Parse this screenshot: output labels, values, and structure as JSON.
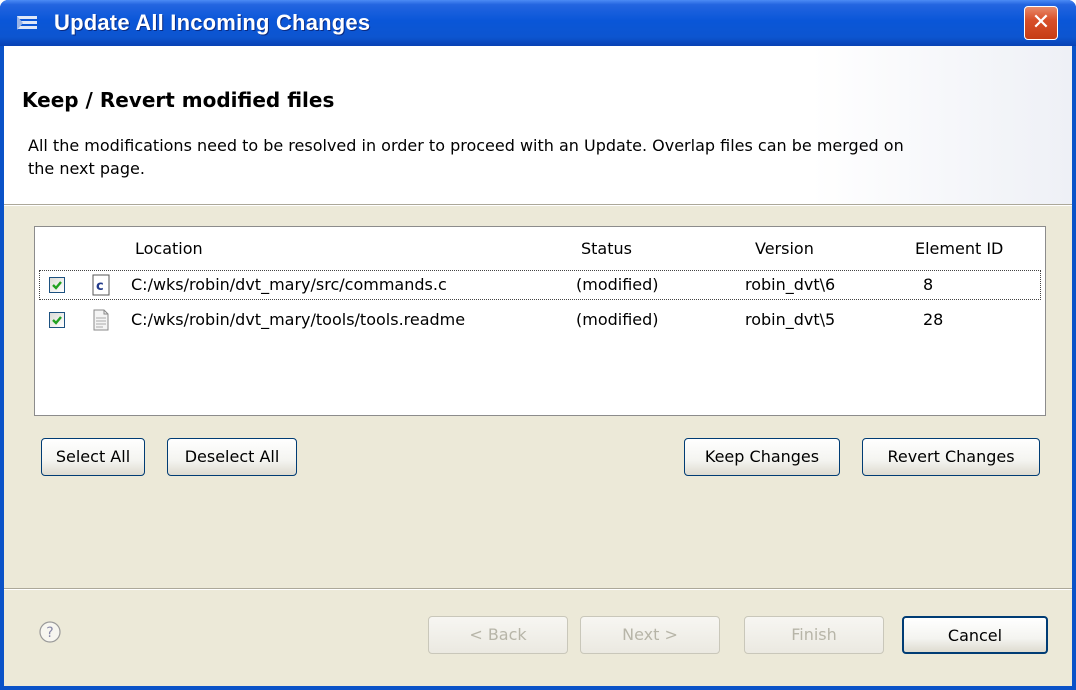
{
  "window": {
    "title": "Update All Incoming Changes",
    "close_glyph": "✕"
  },
  "header": {
    "title": "Keep / Revert modified files",
    "description": "All the modifications need to be resolved in order to proceed with an Update. Overlap files can be merged on the next page."
  },
  "table": {
    "columns": [
      "Location",
      "Status",
      "Version",
      "Element ID"
    ],
    "rows": [
      {
        "checked": true,
        "icon": "c-source-file-icon",
        "location": "C:/wks/robin/dvt_mary/src/commands.c",
        "status": "(modified)",
        "version": "robin_dvt\\6",
        "element_id": "8"
      },
      {
        "checked": true,
        "icon": "text-file-icon",
        "location": "C:/wks/robin/dvt_mary/tools/tools.readme",
        "status": "(modified)",
        "version": "robin_dvt\\5",
        "element_id": "28"
      }
    ]
  },
  "buttons": {
    "select_all": "Select All",
    "deselect_all": "Deselect All",
    "keep_changes": "Keep Changes",
    "revert_changes": "Revert Changes",
    "back": "< Back",
    "next": "Next >",
    "finish": "Finish",
    "cancel": "Cancel"
  },
  "colors": {
    "title_bar": "#0a56d8",
    "dialog_bg": "#ece9d8",
    "close_button": "#d8502a"
  }
}
